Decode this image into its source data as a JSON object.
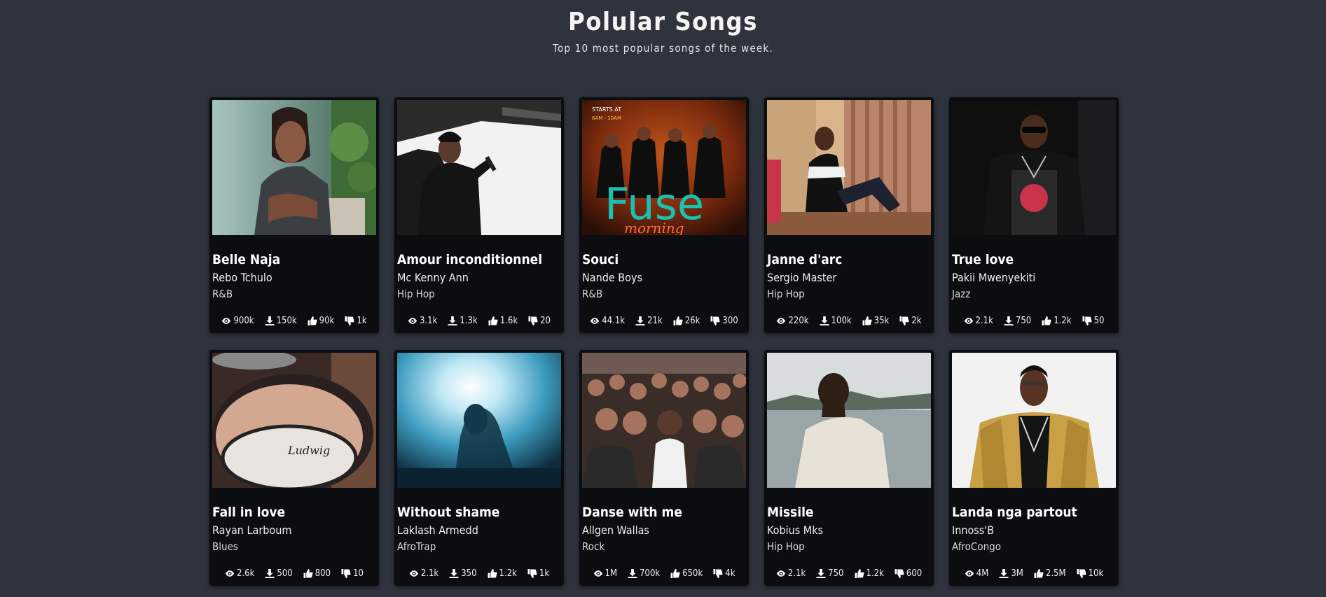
{
  "header": {
    "title": "Polular Songs",
    "subtitle": "Top 10 most popular songs of the week."
  },
  "songs": [
    {
      "title": "Belle Naja",
      "artist": "Rebo Tchulo",
      "genre": "R&B",
      "views": "900k",
      "downloads": "150k",
      "likes": "90k",
      "dislikes": "1k",
      "image": "woman-portrait-photo"
    },
    {
      "title": "Amour inconditionnel",
      "artist": "Mc Kenny Ann",
      "genre": "Hip Hop",
      "views": "3.1k",
      "downloads": "1.3k",
      "likes": "1.6k",
      "dislikes": "20",
      "image": "rapper-on-stage-photo"
    },
    {
      "title": "Souci",
      "artist": "Nande Boys",
      "genre": "R&B",
      "views": "44.1k",
      "downloads": "21k",
      "likes": "26k",
      "dislikes": "300",
      "image": "band-poster-photo",
      "poster_text": {
        "top": "STARTS AT",
        "time": "6AM - 10AM",
        "big": "Fuse",
        "script": "morning"
      }
    },
    {
      "title": "Janne d'arc",
      "artist": "Sergio Master",
      "genre": "Hip Hop",
      "views": "220k",
      "downloads": "100k",
      "likes": "35k",
      "dislikes": "2k",
      "image": "man-sitting-photo"
    },
    {
      "title": "True love",
      "artist": "Pakii Mwenyekiti",
      "genre": "Jazz",
      "views": "2.1k",
      "downloads": "750",
      "likes": "1.2k",
      "dislikes": "50",
      "image": "man-sunglasses-photo"
    },
    {
      "title": "Fall in love",
      "artist": "Rayan Larboum",
      "genre": "Blues",
      "views": "2.6k",
      "downloads": "500",
      "likes": "800",
      "dislikes": "10",
      "image": "drum-kit-photo",
      "drum_text": "Ludwig"
    },
    {
      "title": "Without shame",
      "artist": "Laklash Armedd",
      "genre": "AfroTrap",
      "views": "2.1k",
      "downloads": "350",
      "likes": "1.2k",
      "dislikes": "1k",
      "image": "silhouette-light-photo"
    },
    {
      "title": "Danse with me",
      "artist": "Allgen Wallas",
      "genre": "Rock",
      "views": "1M",
      "downloads": "700k",
      "likes": "650k",
      "dislikes": "4k",
      "image": "concert-crowd-photo"
    },
    {
      "title": "Missile",
      "artist": "Kobius Mks",
      "genre": "Hip Hop",
      "views": "2.1k",
      "downloads": "750",
      "likes": "1.2k",
      "dislikes": "600",
      "image": "man-by-lake-photo"
    },
    {
      "title": "Landa nga partout",
      "artist": "Innoss'B",
      "genre": "AfroCongo",
      "views": "4M",
      "downloads": "3M",
      "likes": "2.5M",
      "dislikes": "10k",
      "image": "gold-jacket-man-photo"
    }
  ],
  "icons": {
    "views": "eye-icon",
    "downloads": "download-icon",
    "likes": "thumbs-up-icon",
    "dislikes": "thumbs-down-icon"
  }
}
